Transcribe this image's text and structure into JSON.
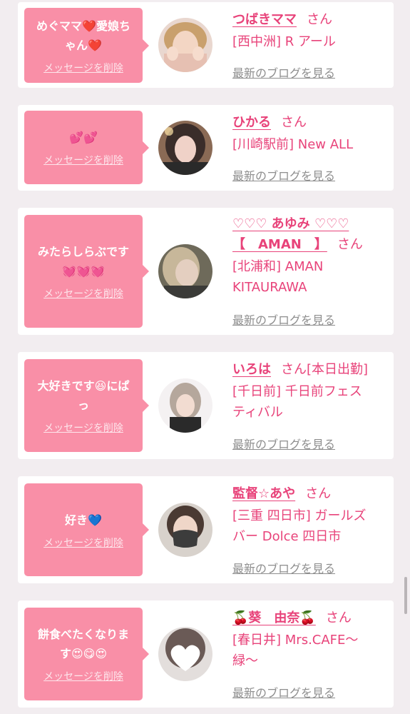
{
  "delete_label": "メッセージを削除",
  "blog_label": "最新のブログを見る",
  "honorific": "さん",
  "colors": {
    "accent": "#e8437a",
    "bubble": "#f98fa7",
    "background": "#f2edf0"
  },
  "cards": [
    {
      "message_lines": [
        "めぐママ❤️愛娘ち",
        "ゃん❤️"
      ],
      "name_lines": [
        "つばきママ"
      ],
      "name_suffix": "",
      "shop_lines": [
        "[西中洲] R アール"
      ],
      "avatar_icon": "girl-photo"
    },
    {
      "message_lines": [
        "💕💕"
      ],
      "name_lines": [
        "ひかる"
      ],
      "name_suffix": "",
      "shop_lines": [
        "[川崎駅前] New ALL"
      ],
      "avatar_icon": "girl-photo"
    },
    {
      "message_lines": [
        "みたらしらぶです",
        "💓💓💓"
      ],
      "name_lines": [
        "♡♡♡ あゆみ ♡♡♡",
        "【　AMAN　】"
      ],
      "name_suffix": "",
      "shop_lines": [
        "[北浦和] AMAN",
        "KITAURAWA"
      ],
      "avatar_icon": "girl-photo"
    },
    {
      "message_lines": [
        "大好きです😆にぱ",
        "っ"
      ],
      "name_lines": [
        "いろは"
      ],
      "name_suffix": "[本日出勤]",
      "shop_lines": [
        "[千日前] 千日前フェス",
        "ティバル"
      ],
      "avatar_icon": "girl-photo"
    },
    {
      "message_lines": [
        "好き💙"
      ],
      "name_lines": [
        "監督☆あや"
      ],
      "name_suffix": "",
      "shop_lines": [
        "[三重 四日市] ガールズ",
        "バー Dolce 四日市"
      ],
      "avatar_icon": "girl-photo-mask"
    },
    {
      "message_lines": [
        "餅食べたくなりま",
        "す😍😋😍"
      ],
      "name_lines": [
        "🍒葵　由奈🍒"
      ],
      "name_suffix": "",
      "shop_lines": [
        "[春日井] Mrs.CAFE～",
        "緑～"
      ],
      "avatar_icon": "girl-photo-heart"
    }
  ]
}
